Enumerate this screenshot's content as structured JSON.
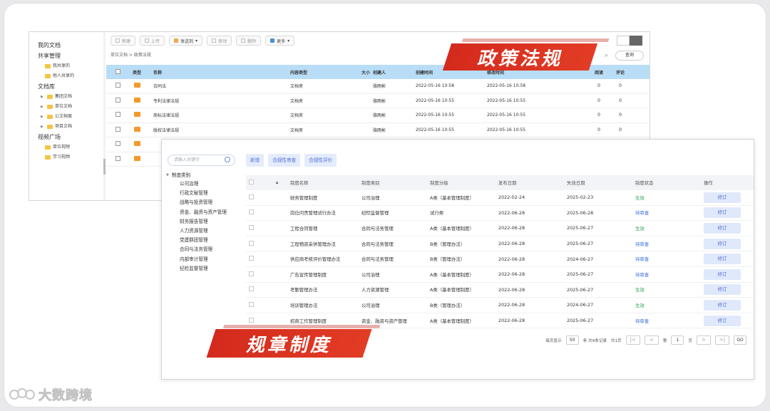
{
  "colors": {
    "banner_red": "#d42a1d",
    "header_blue": "#b9ddf6",
    "status_green": "#2fa05a",
    "status_blue": "#3b6fd8",
    "accent_blue": "#4f6fd6"
  },
  "win1": {
    "sidebar": {
      "my_docs": "我的文档",
      "shared": "共享管理",
      "shared_items": [
        "我共享的",
        "他人共享的"
      ],
      "library": "文档库",
      "library_items": [
        "集团文档",
        "单位文档",
        "公文档案",
        "项目文档"
      ],
      "video": "视频广场",
      "video_items": [
        "单位视频",
        "学习视频"
      ]
    },
    "toolbar": [
      "新建",
      "上传",
      "发送到",
      "移动",
      "删除",
      "更多"
    ],
    "breadcrumb": "单位文档 > 政策法规",
    "query_button": "查询",
    "headers": {
      "type": "类型",
      "name": "名称",
      "content_type": "内容类型",
      "size": "大小",
      "creator": "创建人",
      "created": "创建时间",
      "modified": "修改时间",
      "reads": "阅读",
      "comments": "评论"
    },
    "rows": [
      {
        "name": "合同法",
        "content_type": "文档夹",
        "creator": "骆雨彬",
        "created": "2022-05-16 10:58",
        "modified": "2022-05-16 10:58",
        "reads": "0",
        "comments": "0"
      },
      {
        "name": "专利法律法规",
        "content_type": "文档夹",
        "creator": "骆雨彬",
        "created": "2022-05-16 10:55",
        "modified": "2022-05-16 10:55",
        "reads": "0",
        "comments": "0"
      },
      {
        "name": "商标法律法规",
        "content_type": "文档夹",
        "creator": "骆雨彬",
        "created": "2022-05-16 10:55",
        "modified": "2022-05-16 10:55",
        "reads": "0",
        "comments": "0"
      },
      {
        "name": "版权法律法规",
        "content_type": "文档夹",
        "creator": "骆雨彬",
        "created": "2022-05-16 10:55",
        "modified": "2022-05-16 10:55",
        "reads": "0",
        "comments": "0"
      },
      {
        "name": "",
        "content_type": "",
        "creator": "",
        "created": "",
        "modified": "",
        "reads": "",
        "comments": ""
      },
      {
        "name": "",
        "content_type": "",
        "creator": "",
        "created": "",
        "modified": "",
        "reads": "",
        "comments": ""
      }
    ]
  },
  "banner_top": "政策法规",
  "banner_bottom": "规章制度",
  "win2": {
    "search_placeholder": "请输入关键字",
    "tree_root": "制度类别",
    "tree_items": [
      "公司治理",
      "行政文秘管理",
      "战略与投资管理",
      "资金、融资与资产管理",
      "财务报告管理",
      "人力资源管理",
      "党建群团管理",
      "合同与法务管理",
      "内部审计管理",
      "纪检监督管理"
    ],
    "buttons": [
      "新增",
      "合规性审查",
      "合规性评价"
    ],
    "headers": {
      "name": "制度名称",
      "category": "制度类别",
      "class": "制度分级",
      "published": "发布日期",
      "expires": "失效日期",
      "status": "制度状态",
      "ops": "操作"
    },
    "rows": [
      {
        "name": "财务管理制度",
        "category": "公司治理",
        "class": "A类（基本管理制度）",
        "published": "2022-02-24",
        "expires": "2025-02-23",
        "status": "生效",
        "op": "修订"
      },
      {
        "name": "岗位问责管理试行办法",
        "category": "纪检监督管理",
        "class": "试行类",
        "published": "2022-06-28",
        "expires": "2025-06-28",
        "status": "待审查",
        "op": "修订"
      },
      {
        "name": "工程合同管理",
        "category": "合同与法务管理",
        "class": "A类（基本管理制度）",
        "published": "2022-06-28",
        "expires": "2025-06-27",
        "status": "生效",
        "op": "修订"
      },
      {
        "name": "工程物资采供管理办法",
        "category": "合同与法务管理",
        "class": "B类（管理办法）",
        "published": "2022-06-28",
        "expires": "2025-06-27",
        "status": "待审查",
        "op": "修订"
      },
      {
        "name": "供应商考核评价管理办法",
        "category": "合同与法务管理",
        "class": "B类（管理办法）",
        "published": "2022-06-28",
        "expires": "2024-06-27",
        "status": "待审查",
        "op": "修订"
      },
      {
        "name": "广告宣传管理制度",
        "category": "公司治理",
        "class": "A类（基本管理制度）",
        "published": "2022-06-28",
        "expires": "2025-06-27",
        "status": "待审查",
        "op": "修订"
      },
      {
        "name": "考勤管理办法",
        "category": "人力资源管理",
        "class": "A类（基本管理制度）",
        "published": "2022-06-28",
        "expires": "2025-06-27",
        "status": "生效",
        "op": "修订"
      },
      {
        "name": "培训管理办法",
        "category": "公司治理",
        "class": "B类（管理办法）",
        "published": "2022-06-28",
        "expires": "2024-06-27",
        "status": "生效",
        "op": "修订"
      },
      {
        "name": "招商工作管理制度",
        "category": "资金、融资与资产管理",
        "class": "A类（基本管理制度）",
        "published": "2022-06-28",
        "expires": "2025-06-27",
        "status": "待审查",
        "op": "修订"
      }
    ],
    "pager": {
      "per_page_label": "每页显示",
      "per_page": "50",
      "total_label": "条 共9条记录",
      "pages_label": "共1页",
      "page_prefix": "第",
      "page": "1",
      "page_suffix": "页",
      "go": "GO"
    }
  },
  "logo_text": "大数跨境"
}
